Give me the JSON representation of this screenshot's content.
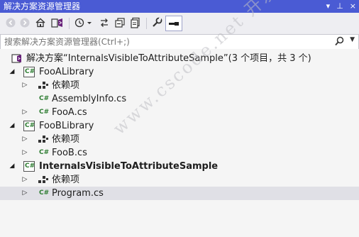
{
  "window": {
    "title": "解决方案资源管理器",
    "controls": [
      "▾",
      "⊥",
      "×"
    ]
  },
  "toolbar": {
    "buttons": [
      "back-icon",
      "forward-icon",
      "home-icon",
      "vs-switch-icon",
      "history-icon",
      "sync-icon",
      "collapse-all-icon",
      "show-all-files-icon",
      "properties-icon",
      "preview-icon"
    ]
  },
  "search": {
    "placeholder": "搜索解决方案资源管理器(Ctrl+;)"
  },
  "tree": {
    "solution": {
      "label": "解决方案“InternalsVisibleToAttributeSample”(3 个项目，共 3 个)"
    },
    "projects": [
      {
        "name": "FooALibrary",
        "dependencies": "依赖项",
        "files": [
          "AssemblyInfo.cs",
          "FooA.cs"
        ]
      },
      {
        "name": "FooBLibrary",
        "dependencies": "依赖项",
        "files": [
          "FooB.cs"
        ]
      },
      {
        "name": "InternalsVisibleToAttributeSample",
        "dependencies": "依赖项",
        "files": [
          "Program.cs"
        ]
      }
    ],
    "cs_badge": "C#"
  },
  "watermark": "www.cscode.net 开发框架文库",
  "colors": {
    "titlebar": "#4a5bd4",
    "selection": "#e0e0e6",
    "cs_green": "#2e7d32",
    "vs_purple": "#68217a"
  }
}
